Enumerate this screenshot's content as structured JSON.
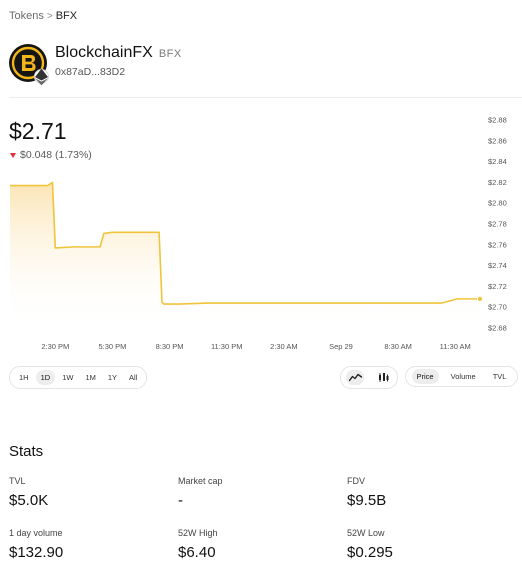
{
  "breadcrumb": {
    "root": "Tokens",
    "separator": ">",
    "current": "BFX"
  },
  "token": {
    "name": "BlockchainFX",
    "symbol": "BFX",
    "address": "0x87aD...83D2",
    "logo_icon": "bfx-logo-icon",
    "chain_icon": "ethereum-icon"
  },
  "price": {
    "value": "$2.71",
    "change": "$0.048 (1.73%)",
    "direction": "down"
  },
  "colors": {
    "line": "#f0c43a",
    "fill_top": "#fbe3b0",
    "down": "#e5303a",
    "accent_bg": "#ededed"
  },
  "chart_data": {
    "type": "area",
    "x_tick_labels": [
      "2:30 PM",
      "5:30 PM",
      "8:30 PM",
      "11:30 PM",
      "2:30 AM",
      "Sep 29",
      "8:30 AM",
      "11:30 AM"
    ],
    "y_tick_labels": [
      "$2.88",
      "$2.86",
      "$2.84",
      "$2.82",
      "$2.80",
      "$2.78",
      "$2.76",
      "$2.74",
      "$2.72",
      "$2.70",
      "$2.68"
    ],
    "ylim": [
      2.68,
      2.88
    ],
    "x_unit": "hours from 2:30 PM",
    "x": [
      -2.38,
      -0.4,
      -0.15,
      0.0,
      1.0,
      2.0,
      2.35,
      2.55,
      3.0,
      4.3,
      5.45,
      5.6,
      5.7,
      6.5,
      8,
      12,
      15,
      18,
      20.3,
      21.1,
      22.3
    ],
    "y": [
      2.817,
      2.817,
      2.82,
      2.757,
      2.758,
      2.758,
      2.758,
      2.771,
      2.772,
      2.772,
      2.772,
      2.705,
      2.703,
      2.703,
      2.704,
      2.704,
      2.704,
      2.704,
      2.704,
      2.708,
      2.708
    ],
    "grid": false
  },
  "timeframes": [
    "1H",
    "1D",
    "1W",
    "1M",
    "1Y",
    "All"
  ],
  "timeframe_active": "1D",
  "chart_types": [
    {
      "icon": "line-chart-icon",
      "active": true
    },
    {
      "icon": "candlestick-chart-icon",
      "active": false
    }
  ],
  "metrics": [
    "Price",
    "Volume",
    "TVL"
  ],
  "metric_active": "Price",
  "stats": {
    "title": "Stats",
    "items": [
      {
        "label": "TVL",
        "value": "$5.0K"
      },
      {
        "label": "Market cap",
        "value": "-"
      },
      {
        "label": "FDV",
        "value": "$9.5B"
      },
      {
        "label": "1 day volume",
        "value": "$132.90"
      },
      {
        "label": "52W High",
        "value": "$6.40"
      },
      {
        "label": "52W Low",
        "value": "$0.295"
      }
    ]
  }
}
